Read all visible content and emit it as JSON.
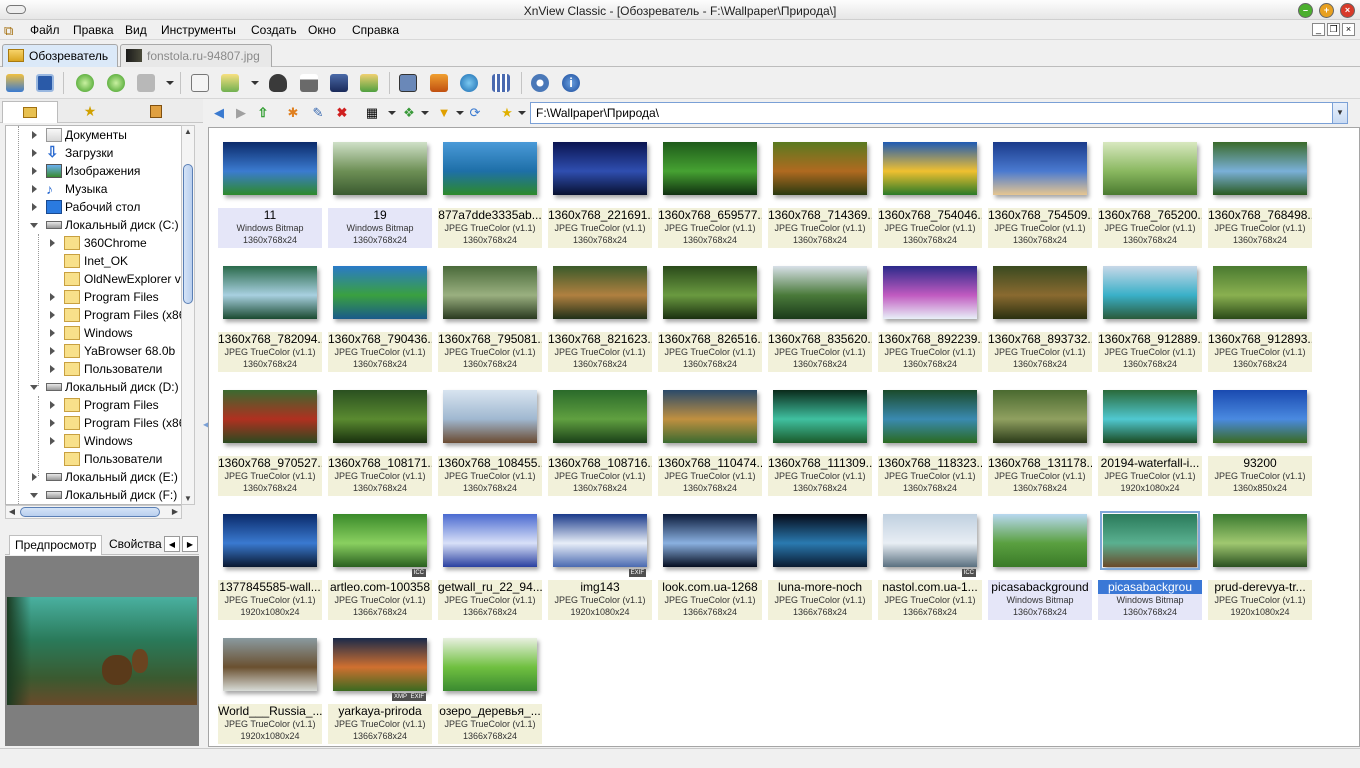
{
  "window": {
    "title": "XnView Classic - [Обозреватель - F:\\Wallpaper\\Природа\\]"
  },
  "menu": [
    "Файл",
    "Правка",
    "Вид",
    "Инструменты",
    "Создать",
    "Окно",
    "Справка"
  ],
  "tabs": [
    {
      "label": "Обозреватель",
      "active": true
    },
    {
      "label": "fonstola.ru-94807.jpg",
      "active": false
    }
  ],
  "address": {
    "path": "F:\\Wallpaper\\Природа\\"
  },
  "tree": [
    {
      "label": "Документы"
    },
    {
      "label": "Загрузки"
    },
    {
      "label": "Изображения"
    },
    {
      "label": "Музыка"
    },
    {
      "label": "Рабочий стол"
    },
    {
      "label": "Локальный диск (C:)"
    },
    {
      "label": "360Chrome"
    },
    {
      "label": "Inet_OK"
    },
    {
      "label": "OldNewExplorer v"
    },
    {
      "label": "Program Files"
    },
    {
      "label": "Program Files (x86"
    },
    {
      "label": "Windows"
    },
    {
      "label": "YaBrowser 68.0b"
    },
    {
      "label": "Пользователи"
    },
    {
      "label": "Локальный диск (D:)"
    },
    {
      "label": "Program Files"
    },
    {
      "label": "Program Files (x86"
    },
    {
      "label": "Windows"
    },
    {
      "label": "Пользователи"
    },
    {
      "label": "Локальный диск (E:)"
    },
    {
      "label": "Локальный диск (F:)"
    }
  ],
  "preview_tabs": [
    "Предпросмотр",
    "Свойства"
  ],
  "files": [
    {
      "name": "11",
      "format": "Windows Bitmap",
      "size": "1360x768x24",
      "style": "bmp",
      "colors": [
        "#0b2a6a",
        "#3b7bd0",
        "#2e8a2a"
      ]
    },
    {
      "name": "19",
      "format": "Windows Bitmap",
      "size": "1360x768x24",
      "style": "bmp",
      "colors": [
        "#cfe0c8",
        "#6d8f55",
        "#3a5a30"
      ]
    },
    {
      "name": "877a7dde3335ab...",
      "format": "JPEG TrueColor (v1.1)",
      "size": "1360x768x24",
      "colors": [
        "#4a9ad8",
        "#1e6fa8",
        "#2d8a2a"
      ]
    },
    {
      "name": "1360x768_221691...",
      "format": "JPEG TrueColor (v1.1)",
      "size": "1360x768x24",
      "colors": [
        "#0a1450",
        "#2f4eb0",
        "#081030"
      ]
    },
    {
      "name": "1360x768_659577...",
      "format": "JPEG TrueColor (v1.1)",
      "size": "1360x768x24",
      "colors": [
        "#1e5a1a",
        "#46a232",
        "#103010"
      ]
    },
    {
      "name": "1360x768_714369...",
      "format": "JPEG TrueColor (v1.1)",
      "size": "1360x768x24",
      "colors": [
        "#5a7a20",
        "#b06a20",
        "#2a3a10"
      ]
    },
    {
      "name": "1360x768_754046...",
      "format": "JPEG TrueColor (v1.1)",
      "size": "1360x768x24",
      "colors": [
        "#1e5ab4",
        "#f0c030",
        "#2a7a28"
      ]
    },
    {
      "name": "1360x768_754509...",
      "format": "JPEG TrueColor (v1.1)",
      "size": "1360x768x24",
      "colors": [
        "#1a3a8a",
        "#4a7ad0",
        "#e6c690"
      ]
    },
    {
      "name": "1360x768_765200...",
      "format": "JPEG TrueColor (v1.1)",
      "size": "1360x768x24",
      "colors": [
        "#d8e8c0",
        "#8ab860",
        "#4a7a30"
      ]
    },
    {
      "name": "1360x768_768498...",
      "format": "JPEG TrueColor (v1.1)",
      "size": "1360x768x24",
      "colors": [
        "#3a6a2a",
        "#7ab0d8",
        "#2a5a20"
      ]
    },
    {
      "name": "1360x768_782094...",
      "format": "JPEG TrueColor (v1.1)",
      "size": "1360x768x24",
      "colors": [
        "#2a6a4a",
        "#a8d0e0",
        "#1a4a30"
      ]
    },
    {
      "name": "1360x768_790436...",
      "format": "JPEG TrueColor (v1.1)",
      "size": "1360x768x24",
      "colors": [
        "#2a7ac8",
        "#3aa040",
        "#1a5a8a"
      ]
    },
    {
      "name": "1360x768_795081...",
      "format": "JPEG TrueColor (v1.1)",
      "size": "1360x768x24",
      "colors": [
        "#4a6a3a",
        "#9ab080",
        "#2a3a20"
      ]
    },
    {
      "name": "1360x768_821623...",
      "format": "JPEG TrueColor (v1.1)",
      "size": "1360x768x24",
      "colors": [
        "#3a5a2a",
        "#b08040",
        "#203018"
      ]
    },
    {
      "name": "1360x768_826516...",
      "format": "JPEG TrueColor (v1.1)",
      "size": "1360x768x24",
      "colors": [
        "#2a4a1a",
        "#6a9a40",
        "#1a3010"
      ]
    },
    {
      "name": "1360x768_835620...",
      "format": "JPEG TrueColor (v1.1)",
      "size": "1360x768x24",
      "colors": [
        "#d8e0e8",
        "#4a7a3a",
        "#1a3a1a"
      ]
    },
    {
      "name": "1360x768_892239...",
      "format": "JPEG TrueColor (v1.1)",
      "size": "1360x768x24",
      "colors": [
        "#2a2a8a",
        "#c05ac0",
        "#e8f0f8"
      ]
    },
    {
      "name": "1360x768_893732...",
      "format": "JPEG TrueColor (v1.1)",
      "size": "1360x768x24",
      "colors": [
        "#3a4a20",
        "#8a6a30",
        "#2a3010"
      ]
    },
    {
      "name": "1360x768_912889...",
      "format": "JPEG TrueColor (v1.1)",
      "size": "1360x768x24",
      "colors": [
        "#c8d8e8",
        "#3ab0c8",
        "#2a5a3a"
      ]
    },
    {
      "name": "1360x768_912893...",
      "format": "JPEG TrueColor (v1.1)",
      "size": "1360x768x24",
      "colors": [
        "#4a7a30",
        "#8ab050",
        "#2a4a18"
      ]
    },
    {
      "name": "1360x768_970527...",
      "format": "JPEG TrueColor (v1.1)",
      "size": "1360x768x24",
      "colors": [
        "#3a6a30",
        "#b03020",
        "#2a4a20"
      ]
    },
    {
      "name": "1360x768_108171...",
      "format": "JPEG TrueColor (v1.1)",
      "size": "1360x768x24",
      "colors": [
        "#2a5020",
        "#5a8a30",
        "#18300e"
      ]
    },
    {
      "name": "1360x768_108455...",
      "format": "JPEG TrueColor (v1.1)",
      "size": "1360x768x24",
      "colors": [
        "#d8e4f0",
        "#a0b8d0",
        "#6a4a30"
      ]
    },
    {
      "name": "1360x768_108716...",
      "format": "JPEG TrueColor (v1.1)",
      "size": "1360x768x24",
      "colors": [
        "#2a6a2a",
        "#60a040",
        "#1a4018"
      ]
    },
    {
      "name": "1360x768_110474...",
      "format": "JPEG TrueColor (v1.1)",
      "size": "1360x768x24",
      "colors": [
        "#2a4a6a",
        "#c09040",
        "#3a6a30"
      ]
    },
    {
      "name": "1360x768_111309...",
      "format": "JPEG TrueColor (v1.1)",
      "size": "1360x768x24",
      "colors": [
        "#0a2a1a",
        "#40c0a0",
        "#1a5a2a"
      ]
    },
    {
      "name": "1360x768_118323...",
      "format": "JPEG TrueColor (v1.1)",
      "size": "1360x768x24",
      "colors": [
        "#1a4a2a",
        "#3a8ab0",
        "#2a6a20"
      ]
    },
    {
      "name": "1360x768_131178...",
      "format": "JPEG TrueColor (v1.1)",
      "size": "1360x768x24",
      "colors": [
        "#4a6a30",
        "#90a060",
        "#2a3a18"
      ]
    },
    {
      "name": "20194-waterfall-i...",
      "format": "JPEG TrueColor (v1.1)",
      "size": "1920x1080x24",
      "colors": [
        "#2a6a3a",
        "#50c8d0",
        "#1a4a20"
      ]
    },
    {
      "name": "93200",
      "format": "JPEG TrueColor (v1.1)",
      "size": "1360x850x24",
      "colors": [
        "#1a4ab0",
        "#4a8ae0",
        "#3a6a20"
      ]
    },
    {
      "name": "1377845585-wall...",
      "format": "JPEG TrueColor (v1.1)",
      "size": "1920x1080x24",
      "colors": [
        "#0a2a6a",
        "#3a7ad0",
        "#0a1830"
      ]
    },
    {
      "name": "artleo.com-100358",
      "format": "JPEG TrueColor (v1.1)",
      "size": "1366x768x24",
      "badges": [
        "ICC"
      ],
      "colors": [
        "#3a8a2a",
        "#8ad060",
        "#2a6020"
      ]
    },
    {
      "name": "getwall_ru_22_94...",
      "format": "JPEG TrueColor (v1.1)",
      "size": "1366x768x24",
      "colors": [
        "#4a6ad0",
        "#d8e0f8",
        "#2a40a0"
      ]
    },
    {
      "name": "img143",
      "format": "JPEG TrueColor (v1.1)",
      "size": "1920x1080x24",
      "badges": [
        "EXIF"
      ],
      "colors": [
        "#1a3a8a",
        "#e8eef8",
        "#4a6ab0"
      ]
    },
    {
      "name": "look.com.ua-1268",
      "format": "JPEG TrueColor (v1.1)",
      "size": "1366x768x24",
      "colors": [
        "#0a1a3a",
        "#8ab0e0",
        "#050d20"
      ]
    },
    {
      "name": "luna-more-noch",
      "format": "JPEG TrueColor (v1.1)",
      "size": "1366x768x24",
      "colors": [
        "#050a18",
        "#2a7ab0",
        "#0a1a30"
      ]
    },
    {
      "name": "nastol.com.ua-1...",
      "format": "JPEG TrueColor (v1.1)",
      "size": "1366x768x24",
      "badges": [
        "ICC"
      ],
      "colors": [
        "#c0d0e0",
        "#e8eef4",
        "#5a7080"
      ]
    },
    {
      "name": "picasabackground",
      "format": "Windows Bitmap",
      "size": "1360x768x24",
      "style": "bmp",
      "colors": [
        "#b8d8f0",
        "#5aa040",
        "#3a7a28"
      ]
    },
    {
      "name": "picasabackgrou",
      "format": "Windows Bitmap",
      "size": "1360x768x24",
      "style": "bmp",
      "selected": true,
      "colors": [
        "#2a7a5a",
        "#5ab090",
        "#6a4a2a"
      ]
    },
    {
      "name": "prud-derevya-tr...",
      "format": "JPEG TrueColor (v1.1)",
      "size": "1920x1080x24",
      "colors": [
        "#3a7a30",
        "#a0c870",
        "#2a5020"
      ]
    },
    {
      "name": "World___Russia_...",
      "format": "JPEG TrueColor (v1.1)",
      "size": "1920x1080x24",
      "colors": [
        "#8a9aa0",
        "#6a5030",
        "#d8dcd8"
      ]
    },
    {
      "name": "yarkaya-priroda",
      "format": "JPEG TrueColor (v1.1)",
      "size": "1366x768x24",
      "badges": [
        "XMP",
        "EXIF"
      ],
      "colors": [
        "#1a2a4a",
        "#d07030",
        "#3a6a20"
      ]
    },
    {
      "name": "озеро_деревья_...",
      "format": "JPEG TrueColor (v1.1)",
      "size": "1366x768x24",
      "colors": [
        "#e8f0e0",
        "#70c040",
        "#3a8a30"
      ]
    }
  ]
}
